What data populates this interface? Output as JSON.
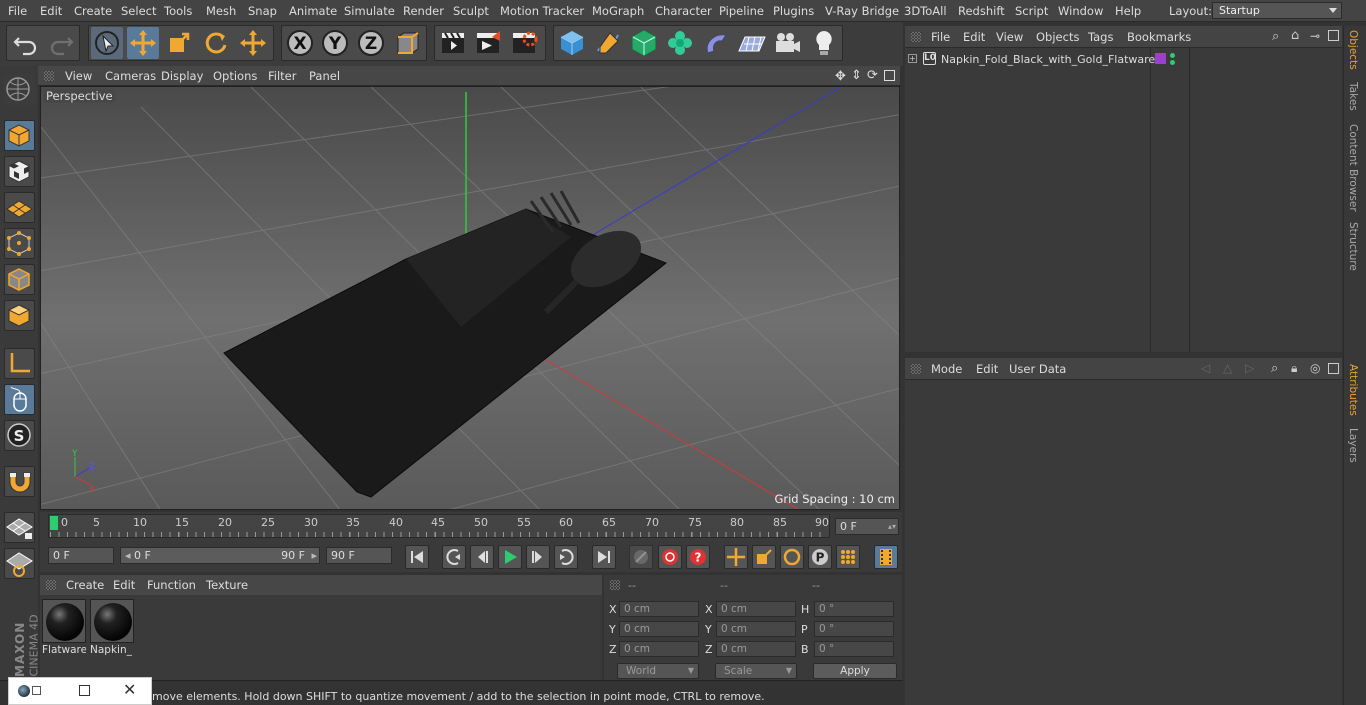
{
  "menubar": {
    "items": [
      "File",
      "Edit",
      "Create",
      "Select",
      "Tools",
      "Mesh",
      "Snap",
      "Animate",
      "Simulate",
      "Render",
      "Sculpt",
      "Motion Tracker",
      "MoGraph",
      "Character",
      "Pipeline",
      "Plugins",
      "V-Ray Bridge",
      "3DToAll",
      "Redshift",
      "Script",
      "Window",
      "Help"
    ],
    "layout_label": "Layout:",
    "layout_value": "Startup"
  },
  "viewport": {
    "menu": [
      "View",
      "Cameras",
      "Display",
      "Options",
      "Filter",
      "Panel"
    ],
    "camera_label": "Perspective",
    "grid_spacing": "Grid Spacing : 10 cm"
  },
  "timeline": {
    "ticks": [
      "0",
      "5",
      "10",
      "15",
      "20",
      "25",
      "30",
      "35",
      "40",
      "45",
      "50",
      "55",
      "60",
      "65",
      "70",
      "75",
      "80",
      "85",
      "90"
    ],
    "current_frame": "0 F"
  },
  "transport": {
    "start_frame": "0 F",
    "range_start": "0 F",
    "range_end": "90 F",
    "end_frame": "90 F"
  },
  "materials": {
    "menu": [
      "Create",
      "Edit",
      "Function",
      "Texture"
    ],
    "items": [
      {
        "name": "Flatware"
      },
      {
        "name": "Napkin_"
      }
    ]
  },
  "coordinates": {
    "headers": [
      "--",
      "--",
      "--"
    ],
    "pos_labels": [
      "X",
      "Y",
      "Z"
    ],
    "pos_values": [
      "0 cm",
      "0 cm",
      "0 cm"
    ],
    "size_labels": [
      "X",
      "Y",
      "Z"
    ],
    "size_values": [
      "0 cm",
      "0 cm",
      "0 cm"
    ],
    "rot_labels": [
      "H",
      "P",
      "B"
    ],
    "rot_values": [
      "0 °",
      "0 °",
      "0 °"
    ],
    "space_select": "World",
    "mode_select": "Scale",
    "apply_label": "Apply"
  },
  "status": {
    "text": "move elements. Hold down SHIFT to quantize movement / add to the selection in point mode, CTRL to remove."
  },
  "object_manager": {
    "menu": [
      "File",
      "Edit",
      "View",
      "Objects",
      "Tags",
      "Bookmarks"
    ],
    "objects": [
      {
        "name": "Napkin_Fold_Black_with_Gold_Flatware",
        "tag_color": "#9b3fd1"
      }
    ]
  },
  "attribute_manager": {
    "menu": [
      "Mode",
      "Edit",
      "User Data"
    ]
  },
  "side_tabs": {
    "top": [
      "Objects",
      "Takes",
      "Content Browser",
      "Structure"
    ],
    "bottom": [
      "Attributes",
      "Layers"
    ]
  },
  "branding": {
    "logo_line1": "MAXON",
    "logo_line2": "CINEMA 4D"
  },
  "colors": {
    "accent": "#e8a23a",
    "axis_x": "#c0392b",
    "axis_y": "#27ae60",
    "axis_z": "#3a3ac0"
  }
}
